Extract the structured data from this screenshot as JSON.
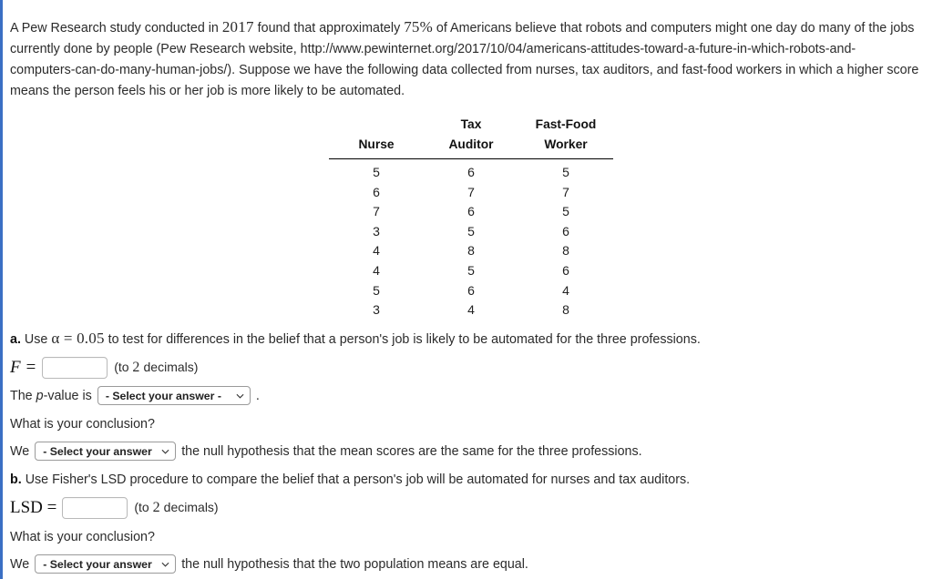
{
  "theme": {
    "accent_border": "#3b6fc4",
    "background": "#ffffff",
    "text": "#222222",
    "rule": "#000000"
  },
  "intro": {
    "part1": "A Pew Research study conducted in ",
    "year": "2017",
    "part2": " found that approximately ",
    "percent": "75%",
    "part3": " of Americans believe that robots and computers might one day do many of the jobs currently done by people (Pew Research website, http://www.pewinternet.org/2017/10/04/americans-attitudes-toward-a-future-in-which-robots-and-computers-can-do-many-human-jobs/). Suppose we have the following data collected from nurses, tax auditors, and fast-food workers in which a higher score means the person feels his or her job is more likely to be automated."
  },
  "table": {
    "columns": [
      {
        "line1": "",
        "line2": "Nurse"
      },
      {
        "line1": "Tax",
        "line2": "Auditor"
      },
      {
        "line1": "Fast-Food",
        "line2": "Worker"
      }
    ],
    "rows": [
      [
        "5",
        "6",
        "5"
      ],
      [
        "6",
        "7",
        "7"
      ],
      [
        "7",
        "6",
        "5"
      ],
      [
        "3",
        "5",
        "6"
      ],
      [
        "4",
        "8",
        "8"
      ],
      [
        "4",
        "5",
        "6"
      ],
      [
        "5",
        "6",
        "4"
      ],
      [
        "3",
        "4",
        "8"
      ]
    ]
  },
  "part_a": {
    "label": "a.",
    "prompt_pre": " Use ",
    "alpha": "α = 0.05",
    "prompt_post": " to test for differences in the belief that a person's job is likely to be automated for the three professions.",
    "f_label": "F =",
    "f_value": "",
    "f_hint_pre": "(to ",
    "f_hint_num": "2",
    "f_hint_post": " decimals)",
    "pvalue_pre": "The ",
    "pvalue_italic": "p",
    "pvalue_mid": "-value is",
    "pvalue_selected": "- Select your answer -",
    "pvalue_options": [
      "- Select your answer -"
    ],
    "period": ".",
    "conclusion_question": "What is your conclusion?",
    "conclusion_pre": "We",
    "conclusion_selected": "- Select your answer -",
    "conclusion_options": [
      "- Select your answer -"
    ],
    "conclusion_post": "the null hypothesis that the mean scores are the same for the three professions."
  },
  "part_b": {
    "label": "b.",
    "prompt": " Use Fisher's LSD procedure to compare the belief that a person's job will be automated for nurses and tax auditors.",
    "lsd_label": "LSD =",
    "lsd_value": "",
    "lsd_hint_pre": "(to ",
    "lsd_hint_num": "2",
    "lsd_hint_post": " decimals)",
    "conclusion_question": "What is your conclusion?",
    "conclusion_pre": "We",
    "conclusion_selected": "- Select your answer -",
    "conclusion_options": [
      "- Select your answer -"
    ],
    "conclusion_post": "the null hypothesis that the two population means are equal."
  }
}
